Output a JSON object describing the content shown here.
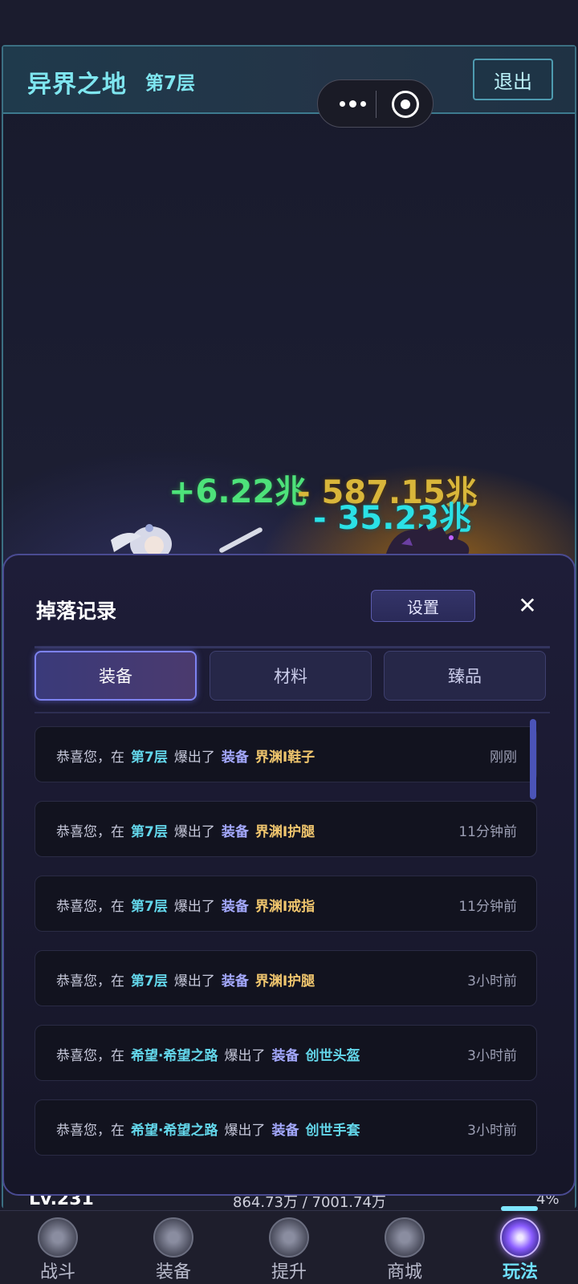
{
  "header": {
    "map_title": "异界之地",
    "floor_label": "第7层",
    "exit_label": "退出"
  },
  "battle": {
    "heal_text": "+6.22兆",
    "damage_gold_text": "- 587.15兆",
    "damage_cyan_text": "- 35.23兆"
  },
  "status_strip": {
    "level": "Lv.231",
    "exp": "864.73万 / 7001.74万",
    "percent": "4%"
  },
  "drop_panel": {
    "title": "掉落记录",
    "settings_label": "设置",
    "tabs": [
      {
        "label": "装备",
        "active": true
      },
      {
        "label": "材料",
        "active": false
      },
      {
        "label": "臻品",
        "active": false
      }
    ],
    "records": [
      {
        "prefix": "恭喜您，在",
        "location": "第7层",
        "verb": "爆出了",
        "category": "装备",
        "item": "界渊I鞋子",
        "time": "刚刚"
      },
      {
        "prefix": "恭喜您，在",
        "location": "第7层",
        "verb": "爆出了",
        "category": "装备",
        "item": "界渊I护腿",
        "time": "11分钟前"
      },
      {
        "prefix": "恭喜您，在",
        "location": "第7层",
        "verb": "爆出了",
        "category": "装备",
        "item": "界渊I戒指",
        "time": "11分钟前"
      },
      {
        "prefix": "恭喜您，在",
        "location": "第7层",
        "verb": "爆出了",
        "category": "装备",
        "item": "界渊I护腿",
        "time": "3小时前"
      },
      {
        "prefix": "恭喜您，在",
        "location": "希望·希望之路",
        "verb": "爆出了",
        "category": "装备",
        "item": "创世头盔",
        "time": "3小时前"
      },
      {
        "prefix": "恭喜您，在",
        "location": "希望·希望之路",
        "verb": "爆出了",
        "category": "装备",
        "item": "创世手套",
        "time": "3小时前"
      }
    ]
  },
  "nav": {
    "items": [
      {
        "label": "战斗",
        "icon": "battle-icon"
      },
      {
        "label": "装备",
        "icon": "equipment-icon"
      },
      {
        "label": "提升",
        "icon": "upgrade-icon"
      },
      {
        "label": "商城",
        "icon": "shop-icon"
      },
      {
        "label": "玩法",
        "icon": "gameplay-icon",
        "active": true
      }
    ]
  }
}
